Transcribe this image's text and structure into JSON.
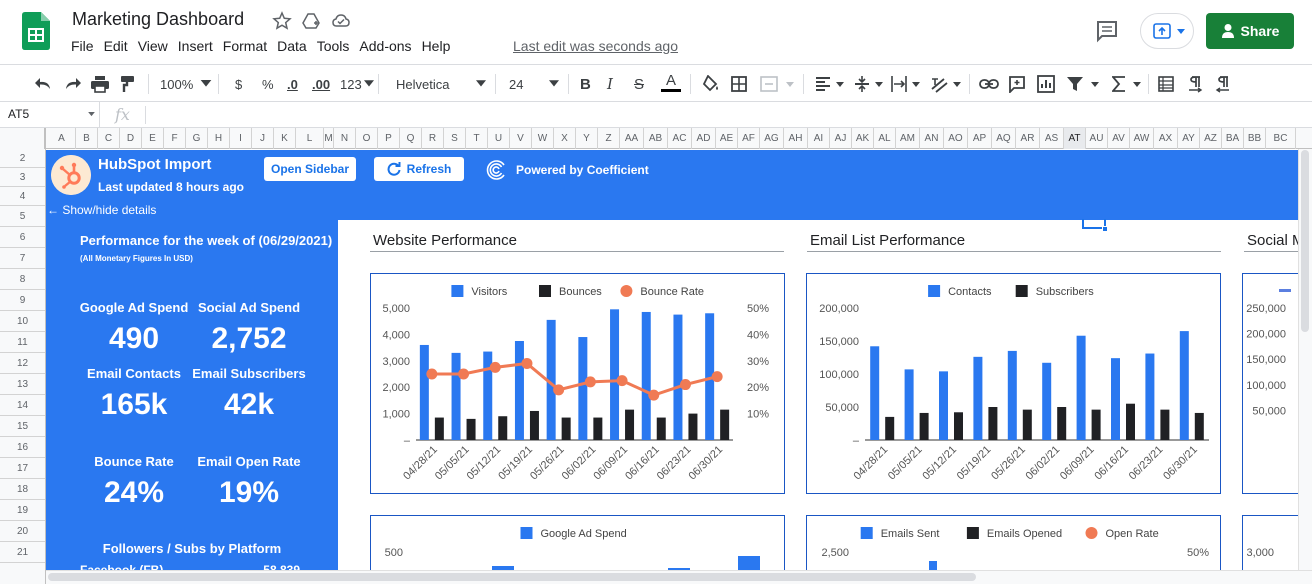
{
  "app": {
    "doc_title": "Marketing Dashboard",
    "menu": [
      "File",
      "Edit",
      "View",
      "Insert",
      "Format",
      "Data",
      "Tools",
      "Add-ons",
      "Help"
    ],
    "last_edit": "Last edit was seconds ago",
    "share_label": "Share",
    "brand_green": "#188038",
    "icons": [
      "sheets-logo-icon",
      "star-icon",
      "move-to-drive-icon",
      "cloud-status-icon",
      "comment-icon",
      "present-upload-icon",
      "share-person-icon"
    ]
  },
  "toolbar": {
    "zoom": "100%",
    "currency": "$",
    "percent": "%",
    "dec_decrease": ".0",
    "dec_increase": ".00",
    "more_formats": "123",
    "font": "Helvetica",
    "font_size": "24",
    "bold": "B",
    "italic": "I",
    "strike": "S",
    "text_color": "A",
    "icons": [
      "undo-icon",
      "redo-icon",
      "print-icon",
      "paint-format-icon",
      "fill-color-icon",
      "borders-icon",
      "merge-icon",
      "align-left-icon",
      "valign-icon",
      "text-wrap-icon",
      "text-rotate-icon",
      "link-icon",
      "comment-add-icon",
      "chart-icon",
      "filter-icon",
      "sum-icon",
      "freeze-icon",
      "ltr-icon",
      "rtl-icon"
    ]
  },
  "formula_bar": {
    "cell_ref": "AT5",
    "fx": "fx"
  },
  "grid": {
    "columns": [
      "A",
      "B",
      "C",
      "D",
      "E",
      "F",
      "G",
      "H",
      "I",
      "J",
      "K",
      "L",
      "M",
      "N",
      "O",
      "P",
      "Q",
      "R",
      "S",
      "T",
      "U",
      "V",
      "W",
      "X",
      "Y",
      "Z",
      "AA",
      "AB",
      "AC",
      "AD",
      "AE",
      "AF",
      "AG",
      "AH",
      "AI",
      "AJ",
      "AK",
      "AL",
      "AM",
      "AN",
      "AO",
      "AP",
      "AQ",
      "AR",
      "AS",
      "AT",
      "AU",
      "AV",
      "AW",
      "AX",
      "AY",
      "AZ",
      "BA",
      "BB",
      "BC"
    ],
    "selected_column": "AT",
    "rows": [
      "2",
      "3",
      "4",
      "5",
      "6",
      "7",
      "8",
      "9",
      "10",
      "11",
      "12",
      "13",
      "14",
      "15",
      "16",
      "17",
      "18",
      "19",
      "20",
      "21"
    ]
  },
  "header": {
    "title": "HubSpot Import",
    "updated": "Last updated 8 hours ago",
    "open_sidebar": "Open Sidebar",
    "refresh": "Refresh",
    "powered_by": "Powered by Coefficient",
    "show_hide": "← Show/hide details",
    "accent": "#2a78f0"
  },
  "summary": {
    "week": "Performance for the week of (06/29/2021)",
    "note": "(All Monetary Figures In USD)",
    "kpis": [
      {
        "label": "Google Ad Spend",
        "value": "490"
      },
      {
        "label": "Social Ad Spend",
        "value": "2,752"
      },
      {
        "label": "Email Contacts",
        "value": "165k"
      },
      {
        "label": "Email Subscribers",
        "value": "42k"
      },
      {
        "label": "Bounce Rate",
        "value": "24%"
      },
      {
        "label": "Email Open Rate",
        "value": "19%"
      }
    ],
    "followers_title": "Followers / Subs by Platform",
    "followers": [
      {
        "platform": "Facebook (FB)",
        "value": "58,839"
      }
    ]
  },
  "sections": {
    "website": "Website Performance",
    "email": "Email List Performance",
    "social": "Social M"
  },
  "chart_data": [
    {
      "type": "bar",
      "title": "Website Performance",
      "categories": [
        "04/28/21",
        "05/05/21",
        "05/12/21",
        "05/19/21",
        "05/26/21",
        "06/02/21",
        "06/09/21",
        "06/16/21",
        "06/23/21",
        "06/30/21"
      ],
      "series": [
        {
          "name": "Visitors",
          "axis": "left",
          "color": "#2a78f0",
          "values": [
            3600,
            3300,
            3350,
            3750,
            4550,
            3900,
            4950,
            4850,
            4750,
            4800
          ]
        },
        {
          "name": "Bounces",
          "axis": "left",
          "color": "#202124",
          "values": [
            850,
            800,
            900,
            1100,
            850,
            850,
            1150,
            850,
            1000,
            1150
          ]
        },
        {
          "name": "Bounce Rate",
          "type": "line",
          "axis": "right",
          "color": "#f07a54",
          "values": [
            25,
            25,
            27.5,
            29,
            19,
            22,
            22.5,
            17,
            21,
            24
          ]
        }
      ],
      "ylim": [
        0,
        5000
      ],
      "y_ticks": [
        "5,000",
        "4,000",
        "3,000",
        "2,000",
        "1,000",
        "–"
      ],
      "y2lim": [
        0,
        50
      ],
      "y2_ticks": [
        "50%",
        "40%",
        "30%",
        "20%",
        "10%",
        "0%"
      ],
      "legend": "top"
    },
    {
      "type": "bar",
      "title": "Email List Performance",
      "categories": [
        "04/28/21",
        "05/05/21",
        "05/12/21",
        "05/19/21",
        "05/26/21",
        "06/02/21",
        "06/09/21",
        "06/16/21",
        "06/23/21",
        "06/30/21"
      ],
      "series": [
        {
          "name": "Contacts",
          "color": "#2a78f0",
          "values": [
            142000,
            107000,
            104000,
            126000,
            135000,
            117000,
            158000,
            124000,
            131000,
            165000
          ]
        },
        {
          "name": "Subscribers",
          "color": "#202124",
          "values": [
            35000,
            41000,
            42000,
            50000,
            46000,
            50000,
            46000,
            55000,
            46000,
            41000
          ]
        }
      ],
      "ylim": [
        0,
        200000
      ],
      "y_ticks": [
        "200,000",
        "150,000",
        "100,000",
        "50,000",
        "–"
      ],
      "legend": "top"
    },
    {
      "type": "bar",
      "title": "Social M",
      "y_ticks": [
        "250,000",
        "200,000",
        "150,000",
        "100,000",
        "50,000"
      ],
      "ylim": [
        0,
        250000
      ]
    },
    {
      "type": "bar",
      "series": [
        {
          "name": "Google Ad Spend",
          "color": "#2a78f0"
        }
      ],
      "y_ticks": [
        "500"
      ],
      "legend": "top"
    },
    {
      "type": "bar",
      "series": [
        {
          "name": "Emails Sent",
          "color": "#2a78f0"
        },
        {
          "name": "Emails Opened",
          "color": "#202124"
        },
        {
          "name": "Open Rate",
          "type": "line",
          "color": "#f07a54"
        }
      ],
      "y_ticks": [
        "2,500"
      ],
      "y2_ticks": [
        "50%"
      ],
      "legend": "top"
    },
    {
      "type": "bar",
      "y_ticks": [
        "3,000"
      ]
    }
  ]
}
